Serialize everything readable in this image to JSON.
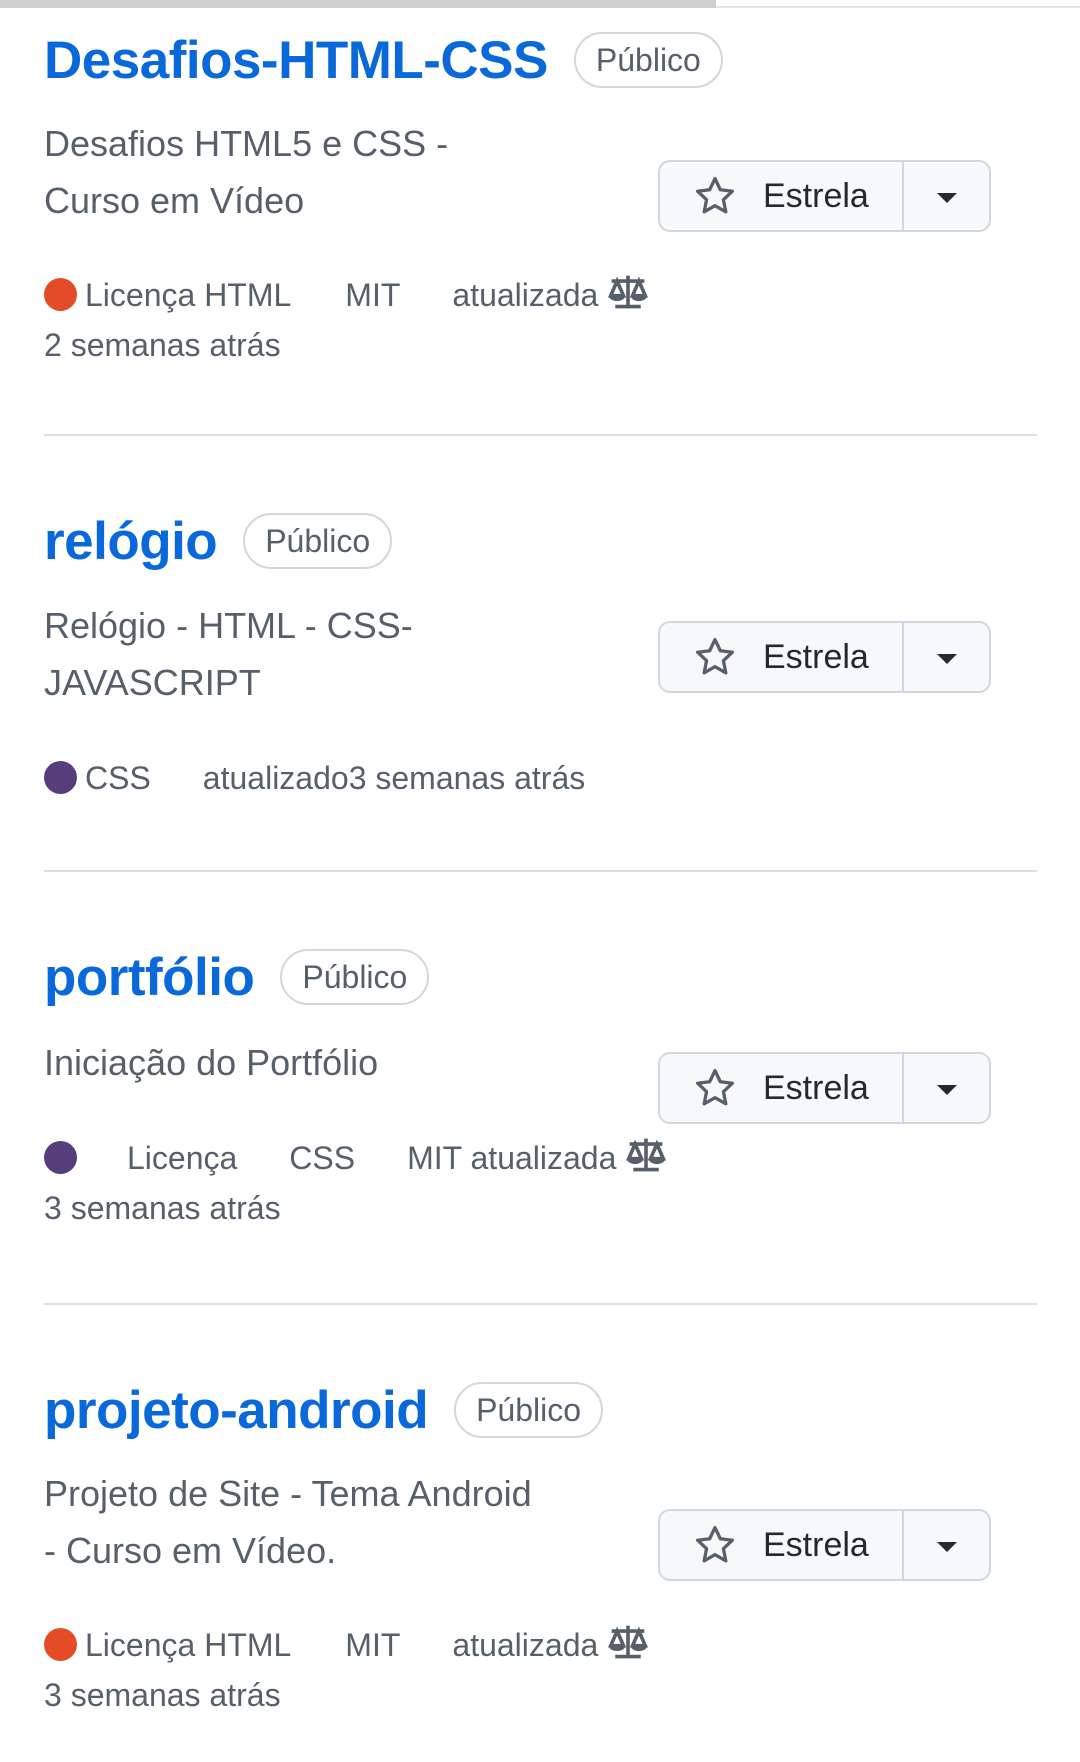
{
  "colors": {
    "link": "#0969da",
    "html_lang": "#e34c26",
    "css_lang": "#563d7c"
  },
  "repos": [
    {
      "name": "Desafios-HTML-CSS",
      "visibility": "Público",
      "desc_line1": "Desafios HTML5 e CSS -",
      "desc_line2": "Curso em Vídeo",
      "meta_language": "Licença HTML",
      "meta_license": "MIT",
      "meta_updated": "atualizada",
      "meta_time": "2 semanas atrás",
      "star_label": "Estrela",
      "lang_color": "#e34c26"
    },
    {
      "name": "relógio",
      "visibility": "Público",
      "desc_line1": "Relógio - HTML - CSS-",
      "desc_line2": "JAVASCRIPT",
      "meta_language": "CSS",
      "meta_updated": "atualizado3 semanas atrás",
      "star_label": "Estrela",
      "lang_color": "#563d7c"
    },
    {
      "name": "portfólio",
      "visibility": "Público",
      "desc_line1": "Iniciação do Portfólio",
      "meta_license_word": "Licença",
      "meta_language": "CSS",
      "meta_updated": "MIT atualizada",
      "meta_time": "3 semanas atrás",
      "star_label": "Estrela",
      "lang_color": "#563d7c"
    },
    {
      "name": "projeto-android",
      "visibility": "Público",
      "desc_line1": "Projeto de Site - Tema Android",
      "desc_line2": "- Curso em Vídeo.",
      "meta_language": "Licença HTML",
      "meta_license": "MIT",
      "meta_updated": "atualizada",
      "meta_time": "3 semanas atrás",
      "star_label": "Estrela",
      "lang_color": "#e34c26"
    }
  ]
}
